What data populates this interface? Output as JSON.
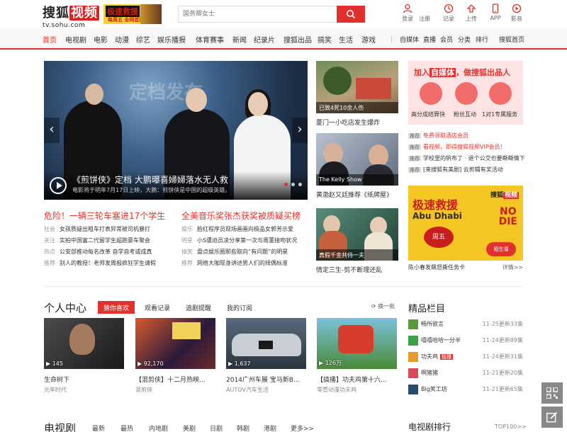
{
  "header": {
    "logo_cn": "搜狐",
    "logo_cn_red": "视频",
    "logo_url": "tv.sohu.com",
    "banner": {
      "title": "极速救援",
      "subtitle": "每周五 全网首播"
    },
    "search_placeholder": "国务卿女士",
    "tools": [
      {
        "label": "登录",
        "icon": "user-icon"
      },
      {
        "label": "注册",
        "icon": "register-icon"
      },
      {
        "label": "记录",
        "icon": "history-icon"
      },
      {
        "label": "上传",
        "icon": "upload-icon"
      },
      {
        "label": "APP",
        "icon": "phone-icon"
      },
      {
        "label": "影音",
        "icon": "play-circle-icon"
      }
    ],
    "accent": "#e2312d"
  },
  "nav": {
    "left": [
      "首页",
      "电视剧",
      "电影",
      "动漫",
      "综艺",
      "娱乐播报",
      "体育赛事",
      "新闻",
      "纪录片",
      "搜狐出品",
      "搞笑",
      "生活",
      "游戏"
    ],
    "right": [
      "自媒体",
      "直播",
      "会员",
      "分类",
      "排行",
      "搜狐首页"
    ]
  },
  "hero": {
    "sign": "定档发布",
    "title": "《煎饼侠》定档 大鹏曝喜婦婦落水无人救",
    "subtitle": "电影将于明年7月17日上映，大鹏：煎饼侠是中国的超级英雄。"
  },
  "headlines": {
    "left": "危险！一辆三轮车塞进17个学生",
    "right": "全美音乐奖张杰获奖被质疑买榜"
  },
  "news_left": [
    {
      "cat": "社会",
      "text": "女孩质疑出租车打表异常被司机暴打"
    },
    {
      "cat": "关注",
      "text": "实拍中国富二代留学生超跑豪车聚会"
    },
    {
      "cat": "热点",
      "text": "公安部推动每名改革 自学自考或成真"
    },
    {
      "cat": "推荐",
      "text": "别人的教授！老师发周报疯狂学生请假"
    }
  ],
  "news_right": [
    {
      "cat": "娱乐",
      "text": "脸红程序员现场画画向极品女郭芳示爱"
    },
    {
      "cat": "明星",
      "text": "小S遭迫员凌分享第一次与周董接吻状况"
    },
    {
      "cat": "搞笑",
      "text": "盘点娱乐圈那些取向“有问题”的明星"
    },
    {
      "cat": "推荐",
      "text": "网络大咖现身讲述男人们的择偶标准"
    }
  ],
  "mid_thumbs": [
    {
      "caption": "已致4死10余人伤",
      "title": "厦门一小吃店发生爆炸"
    },
    {
      "caption": "The Kelly Show",
      "title": "黄渤赵又廷推荐《纸牌屋》"
    },
    {
      "caption": "真假千金共侍一夫",
      "title": "情定三生-剪不断理还乱"
    }
  ],
  "promo": {
    "prefix": "加入",
    "pill": "自媒体",
    "suffix": "，做搜狐出品人",
    "items": [
      "高分成结算快",
      "粉丝互动",
      "1对1专属服务"
    ]
  },
  "promo_list": [
    {
      "tag": "推荐",
      "text": "免费领取酒店会员",
      "red": true
    },
    {
      "tag": "推荐",
      "text": "看视频，即得搜狐视频VIP会员！",
      "red": true
    },
    {
      "tag": "推荐",
      "text": "学校里的帆布了 · 退个公交也要嘶嘶情下",
      "red": false
    },
    {
      "tag": "推荐",
      "text": "[来搜狐有美剧] 云剪辑有奖活动",
      "red": false
    }
  ],
  "ad2": {
    "logo_a": "搜狐",
    "logo_b": "视频",
    "title": "极速救援",
    "abu": "Abu Dhabi",
    "nono": "NO\nDIE",
    "zhou": "周五",
    "bubble": "陌生溜",
    "caption": "陈小春发飙怒撕任务卡",
    "more": "详情>>"
  },
  "personal": {
    "title": "个人中心",
    "tabs": [
      "猜你喜欢",
      "观看记录",
      "追剧提醒",
      "我的订阅"
    ],
    "refresh": "换一批",
    "cards": [
      {
        "count": "145",
        "title": "生命树下",
        "source": "光年时代"
      },
      {
        "count": "92,170",
        "title": "【混剪侠】十二月热映...",
        "source": "混剪侠"
      },
      {
        "count": "1,637",
        "title": "2014广州车展 宝马新B...",
        "source": "AUTOV汽车生活"
      },
      {
        "count": "126万",
        "title": "【搞播】功夫鸡第十六...",
        "source": "零壹动漫功夫鸡"
      }
    ]
  },
  "jingpin": {
    "title": "精品栏目",
    "items": [
      {
        "name": "畅所欲言",
        "hot": "",
        "update": "11-25更新33集"
      },
      {
        "name": "嘻嘻哈哈一分半",
        "hot": "",
        "update": "11-24更新89集"
      },
      {
        "name": "功夫鸡",
        "hot": "独播",
        "update": "11-24更新31集"
      },
      {
        "name": "啊猪猪",
        "hot": "",
        "update": "11-21更新20集"
      },
      {
        "name": "Big笑工坊",
        "hot": "",
        "update": "11-21更新65集"
      }
    ]
  },
  "tv": {
    "title": "电视剧",
    "tabs": [
      "最新",
      "最热",
      "内地剧",
      "美剧",
      "日剧",
      "韩剧",
      "港剧",
      "更多>>"
    ],
    "rank": "电视剧排行",
    "rank_more": "TOP100>>"
  }
}
